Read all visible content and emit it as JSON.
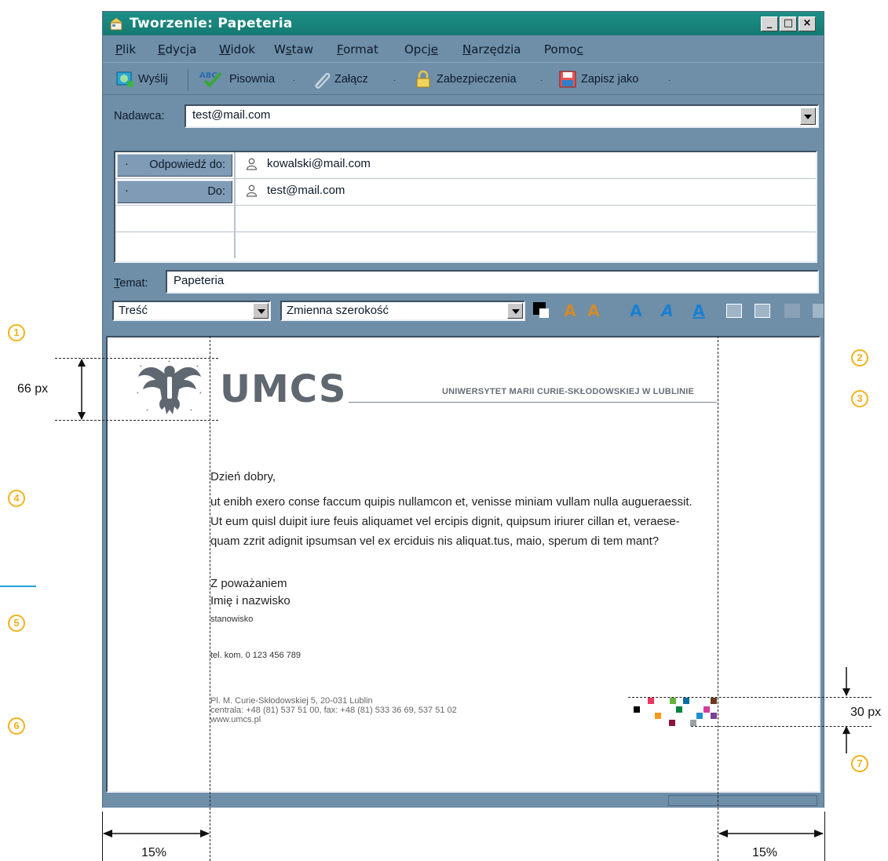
{
  "window": {
    "title": "Tworzenie: Papeteria",
    "controls": [
      "_",
      "□",
      "×"
    ]
  },
  "menu": [
    {
      "label": "Plik",
      "u": "P",
      "rest": "lik"
    },
    {
      "label": "Edycja",
      "u": "E",
      "rest": "dycja"
    },
    {
      "label": "Widok",
      "u": "W",
      "rest": "idok"
    },
    {
      "label": "Wstaw",
      "pre": "W",
      "u": "s",
      "rest": "taw"
    },
    {
      "label": "Format",
      "u": "F",
      "rest": "ormat"
    },
    {
      "label": "Opcje",
      "pre": "Opcj",
      "u": "e",
      "rest": ""
    },
    {
      "label": "Narzędzia",
      "u": "N",
      "rest": "arzędzia"
    },
    {
      "label": "Pomoc",
      "pre": "Pomo",
      "u": "c",
      "rest": ""
    }
  ],
  "toolbar": {
    "send": "Wyślij",
    "spelling": "Pisownia",
    "attach": "Załącz",
    "security": "Zabezpieczenia",
    "save_as": "Zapisz jako",
    "dropdown_glyph": "·"
  },
  "header": {
    "sender_label": "Nadawca:",
    "sender_value": "test@mail.com",
    "rows": [
      {
        "label": "Odpowiedź do:",
        "value": "kowalski@mail.com"
      },
      {
        "label": "Do:",
        "value": "test@mail.com"
      },
      {
        "label": "",
        "value": ""
      },
      {
        "label": "",
        "value": ""
      }
    ],
    "subject_label": "Temat:",
    "subject_value": "Papeteria"
  },
  "format_bar": {
    "paragraph_style": "Treść",
    "font": "Zmienna szerokość"
  },
  "stationery": {
    "logo_text": "UMCS",
    "university_name": "UNIWERSYTET MARII CURIE-SKŁODOWSKIEJ W LUBLINIE",
    "greeting": "Dzień dobry,",
    "body_lines": [
      "ut enibh exero conse faccum quipis nullamcon et, venisse miniam vullam nulla augueraessit.",
      "Ut eum quisl duipit iure feuis aliquamet vel ercipis dignit, quipsum iriurer cillan et, veraese-",
      "quam zzrit adignit ipsumsan vel ex erciduis nis aliquat.tus, maio, sperum di tem mant?"
    ],
    "closing": "Z poważaniem",
    "name": "Imię i nazwisko",
    "position": "stanowisko",
    "phone": "tel. kom. 0 123 456 789",
    "footer_lines": [
      "Pl. M. Curie-Skłodowskiej 5, 20-031 Lublin",
      "centrala: +48 (81) 537 51 00, fax: +48 (81) 533 36 69, 537 51 02",
      "www.umcs.pl"
    ]
  },
  "annotations": {
    "logo_height": "66 px",
    "squares_height": "30 px",
    "left_margin": "15%",
    "right_margin": "15%",
    "badges": [
      "1",
      "2",
      "3",
      "4",
      "5",
      "6",
      "7"
    ],
    "badge_color": "#f2b21b"
  },
  "colors": {
    "title_bar": "#137a72",
    "window_chrome": "#6f8ea8",
    "pixel_squares": [
      "#e8365f",
      "#63b33f",
      "#0a6fa0",
      "#6b3a1f",
      "#000000",
      "#f39a1c",
      "#00833e",
      "#d63c9b",
      "#8a1538",
      "#1f8fcf",
      "#7b3f98",
      "#9aa0a6"
    ]
  }
}
